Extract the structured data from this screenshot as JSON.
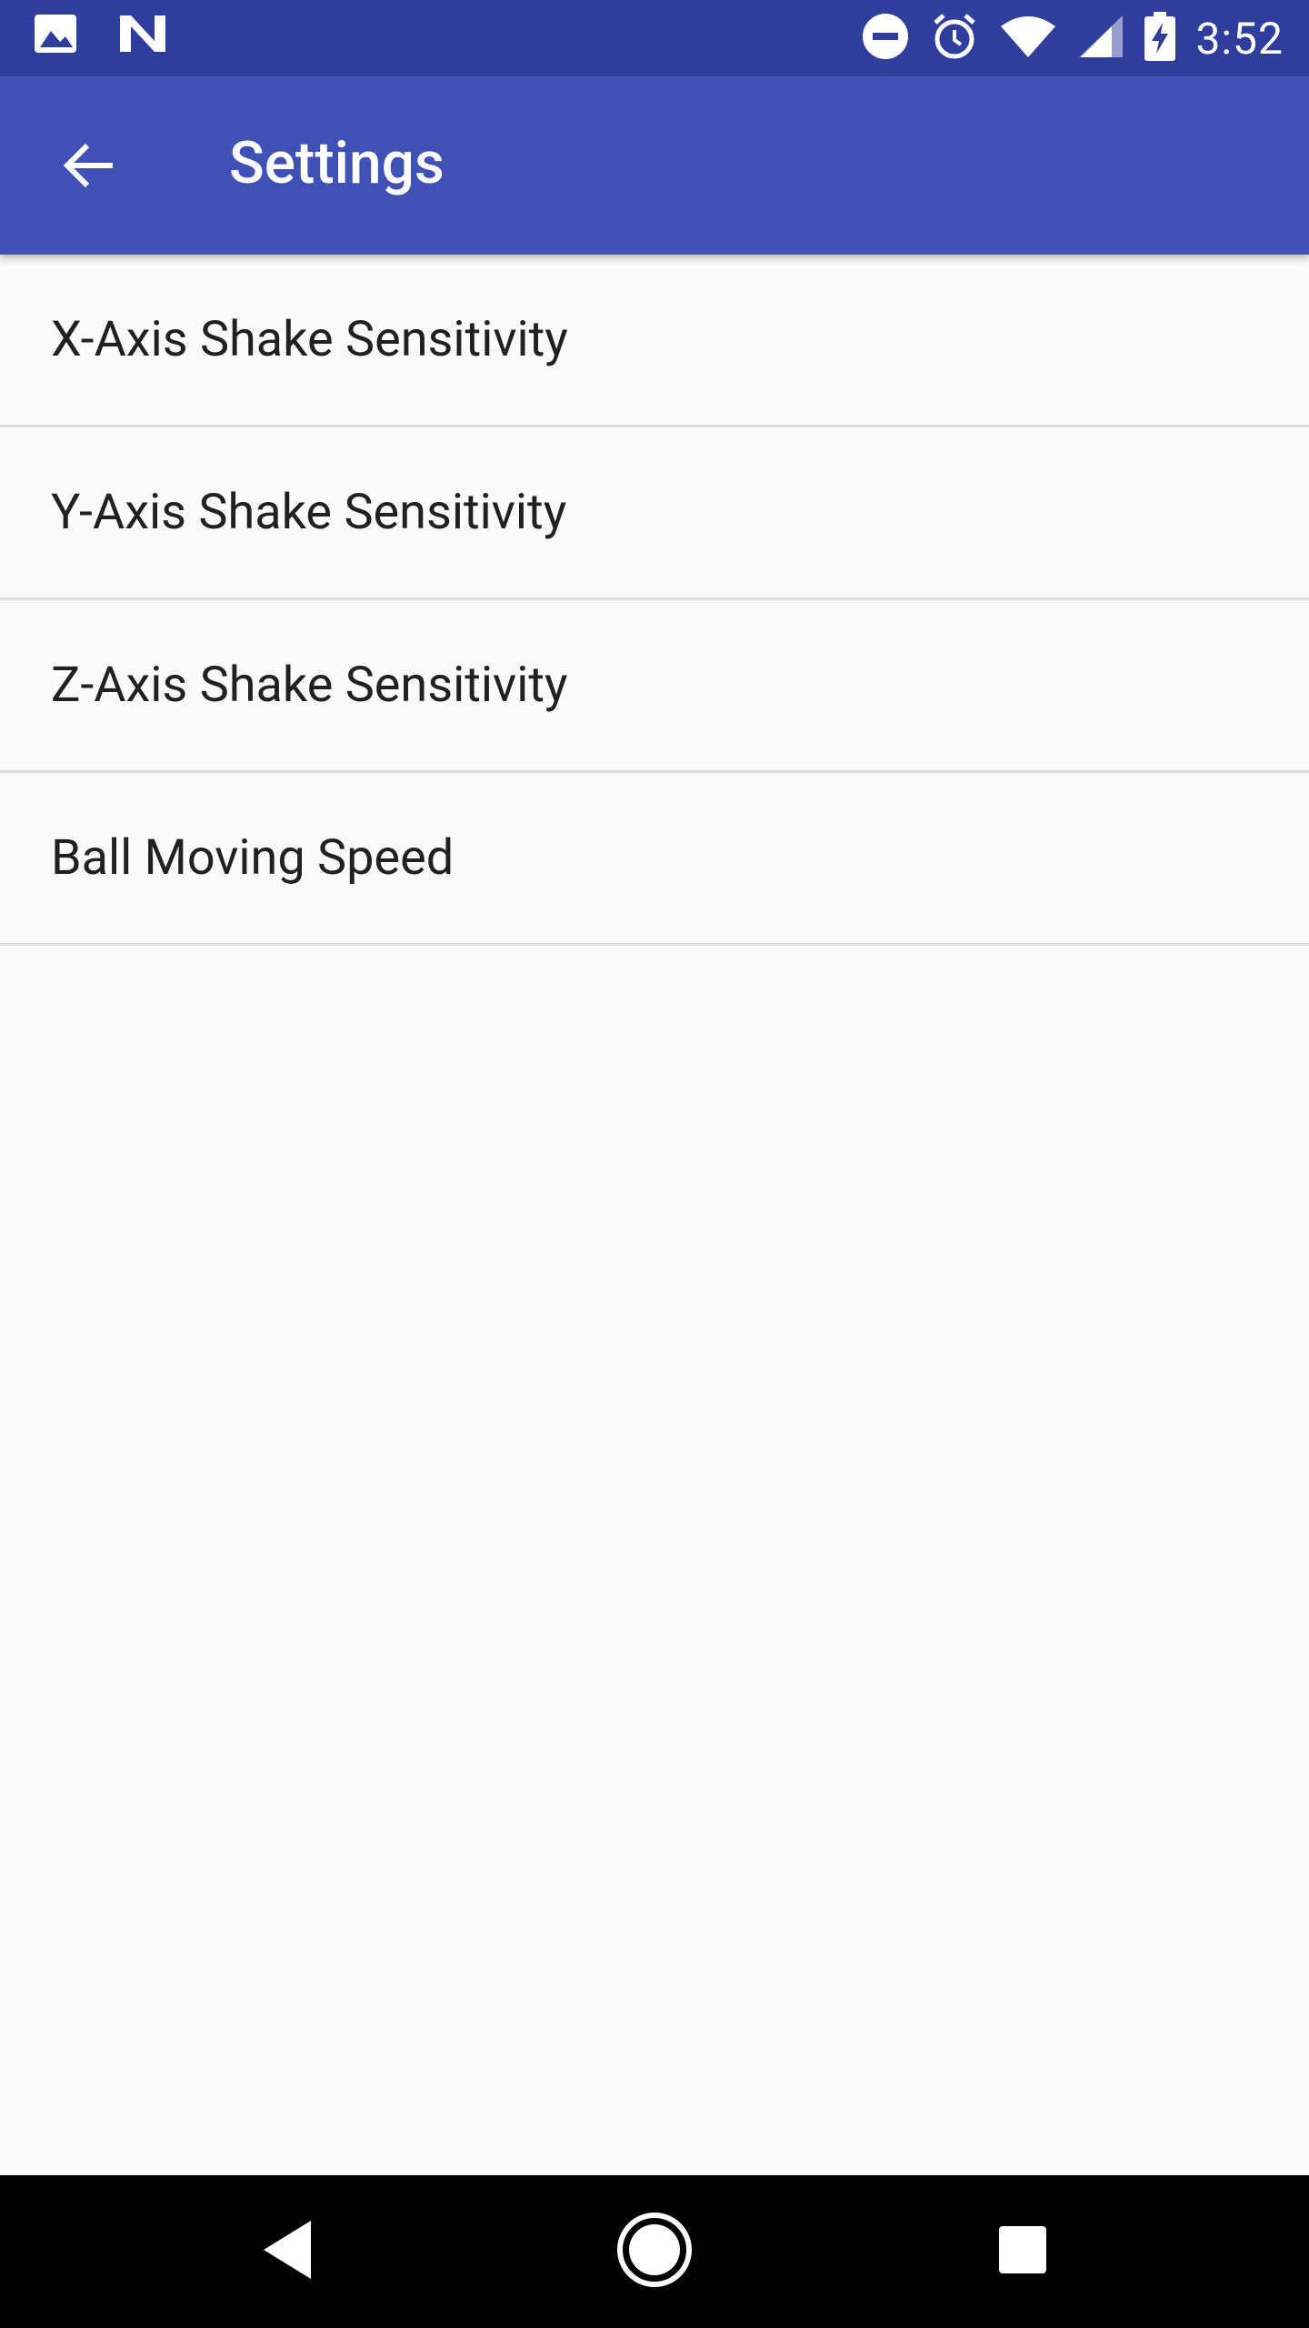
{
  "status_bar": {
    "time": "3:52",
    "left_icons": [
      "image-icon",
      "n-logo-icon"
    ],
    "right_icons": [
      "do-not-disturb-icon",
      "alarm-icon",
      "wifi-icon",
      "signal-icon",
      "battery-charging-icon"
    ]
  },
  "app_bar": {
    "title": "Settings",
    "back_icon": "arrow-back-icon",
    "color": "#3f51b5"
  },
  "settings": {
    "items": [
      {
        "label": "X-Axis Shake Sensitivity"
      },
      {
        "label": "Y-Axis Shake Sensitivity"
      },
      {
        "label": "Z-Axis Shake Sensitivity"
      },
      {
        "label": "Ball Moving Speed"
      }
    ]
  },
  "nav_bar": {
    "buttons": [
      "back-triangle-icon",
      "home-circle-icon",
      "recents-square-icon"
    ]
  }
}
